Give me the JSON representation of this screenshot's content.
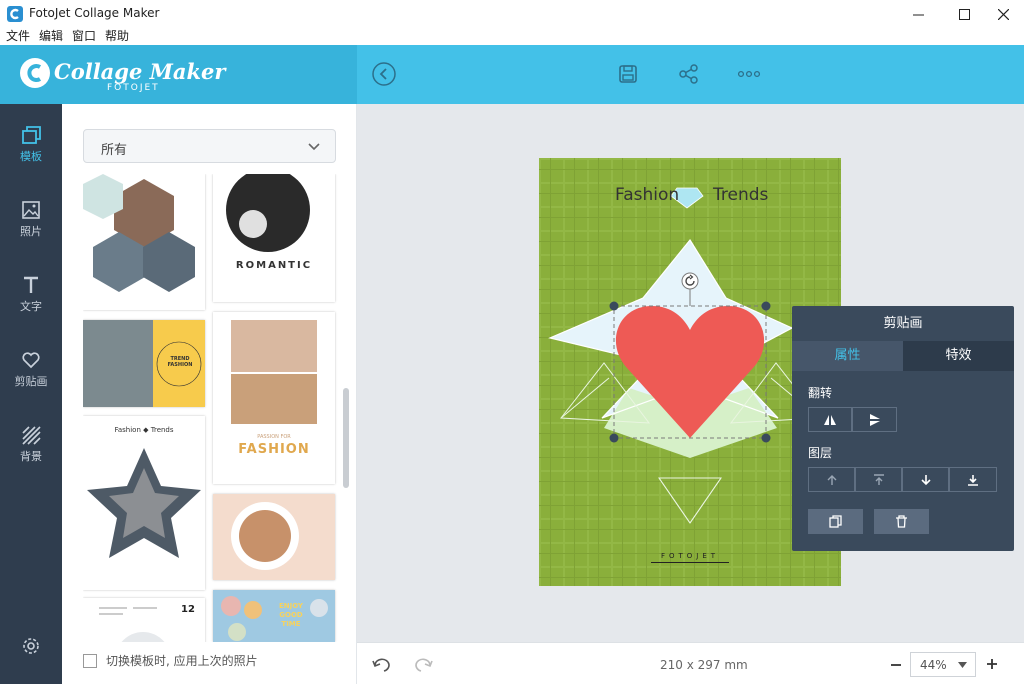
{
  "window": {
    "title": "FotoJet Collage Maker"
  },
  "menu": [
    "文件",
    "编辑",
    "窗口",
    "帮助"
  ],
  "logo": {
    "name": "Collage Maker",
    "sub": "FOTOJET"
  },
  "nav": [
    {
      "label": "模板",
      "icon": "template-icon"
    },
    {
      "label": "照片",
      "icon": "photo-icon"
    },
    {
      "label": "文字",
      "icon": "text-icon"
    },
    {
      "label": "剪贴画",
      "icon": "heart-icon"
    },
    {
      "label": "背景",
      "icon": "background-icon"
    }
  ],
  "panel": {
    "dropdown_value": "所有",
    "footer_checkbox_label": "切换模板时, 应用上次的照片",
    "thumbnails": {
      "romantic_title": "ROMANTIC",
      "trend_title": "TREND FASHION",
      "fashion_title": "FASHION",
      "fashion_pre": "PASSION FOR",
      "star_title_left": "Fashion",
      "star_title_right": "Trends",
      "enjoy_text": "ENJOY GOOD TIME",
      "date_num": "12"
    }
  },
  "canvas": {
    "title_left": "Fashion",
    "title_right": "Trends",
    "brand": "FOTOJET",
    "colors": {
      "background": "#8aaf3b",
      "heart": "#ee5a55",
      "star": "#e6f4fb"
    }
  },
  "clipart_popup": {
    "title": "剪贴画",
    "tabs": [
      "属性",
      "特效"
    ],
    "flip_label": "翻转",
    "layer_label": "图层"
  },
  "bottom": {
    "size_text": "210 x 297 mm",
    "zoom": "44%"
  }
}
